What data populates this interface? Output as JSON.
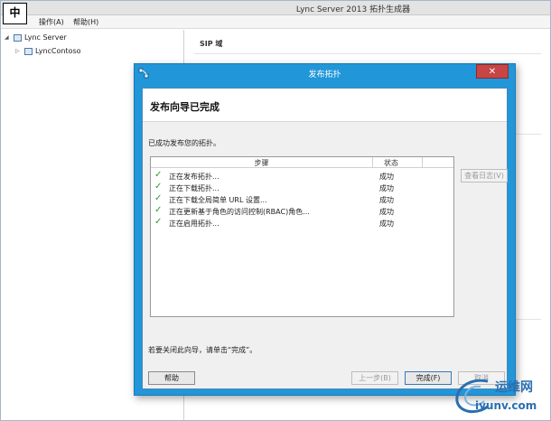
{
  "app": {
    "title": "Lync Server 2013 拓扑生成器",
    "ime_indicator": "中",
    "menu": {
      "action": "操作(A)",
      "help": "帮助(H)"
    }
  },
  "tree": {
    "items": [
      {
        "label": "Lync Server",
        "expander": "◢"
      },
      {
        "label": "LyncContoso",
        "expander": "▷"
      }
    ]
  },
  "details": {
    "section_title": "SIP 域"
  },
  "dialog": {
    "title": "发布拓扑",
    "close_glyph": "✕",
    "heading": "发布向导已完成",
    "status_text": "已成功发布您的拓扑。",
    "columns": {
      "step": "步骤",
      "state": "状态"
    },
    "steps": [
      {
        "label": "正在发布拓扑...",
        "state": "成功"
      },
      {
        "label": "正在下载拓扑...",
        "state": "成功"
      },
      {
        "label": "正在下载全局简单 URL 设置...",
        "state": "成功"
      },
      {
        "label": "正在更新基于角色的访问控制(RBAC)角色...",
        "state": "成功"
      },
      {
        "label": "正在启用拓扑...",
        "state": "成功"
      }
    ],
    "view_log_button": "查看日志(V)",
    "close_hint": "若要关闭此向导，请单击“完成”。",
    "buttons": {
      "help": "帮助",
      "back": "上一步(B)",
      "finish": "完成(F)",
      "cancel": "取消"
    }
  },
  "watermark": {
    "brand": "运维网",
    "site": "iyunv.com"
  },
  "colors": {
    "dialog_frame": "#2196d8",
    "check": "#2f9b2f",
    "close": "#c74545"
  }
}
